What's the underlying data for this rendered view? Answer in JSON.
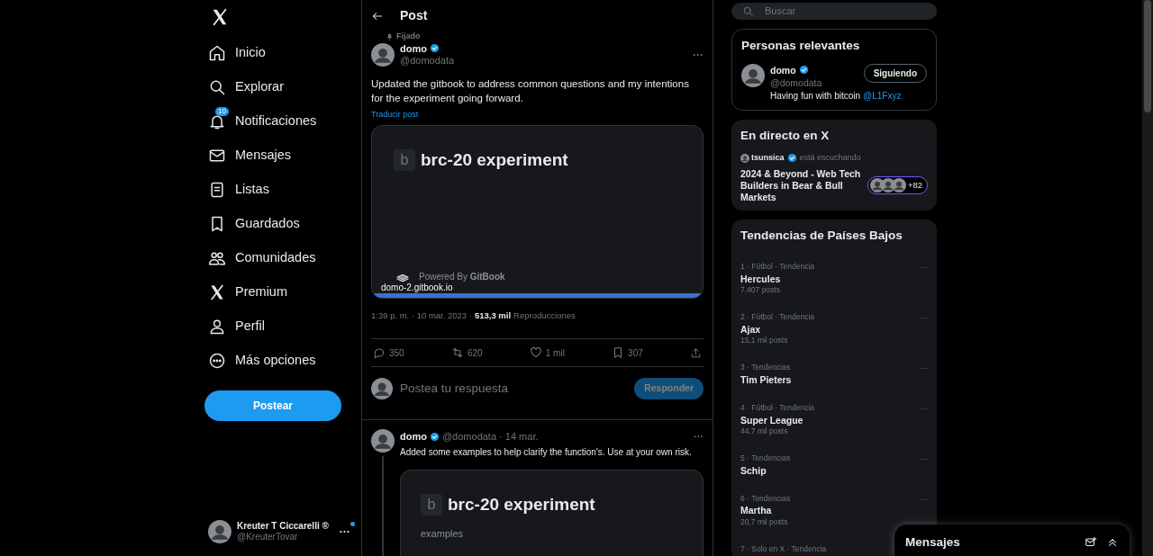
{
  "nav_items": [
    {
      "label": "Inicio"
    },
    {
      "label": "Explorar"
    },
    {
      "label": "Notificaciones",
      "badge": "10"
    },
    {
      "label": "Mensajes"
    },
    {
      "label": "Listas"
    },
    {
      "label": "Guardados"
    },
    {
      "label": "Comunidades"
    },
    {
      "label": "Premium"
    },
    {
      "label": "Perfil"
    },
    {
      "label": "Más opciones"
    }
  ],
  "post_button": "Postear",
  "account": {
    "name": "Kreuter T Ciccarelli ®",
    "handle": "@KreuterTovar",
    "more": "···",
    "unread": true
  },
  "header": {
    "title": "Post"
  },
  "post": {
    "pinned": "Fijado",
    "author": "domo",
    "verified": true,
    "handle": "@domodata",
    "more": "···",
    "text": "Updated the gitbook to address common questions and my intentions for the experiment going forward.",
    "translate": "Traducir post",
    "card": {
      "logo_letter": "b",
      "title": "brc-20 experiment",
      "powered": "Powered By **GitBook**",
      "domain": "domo-2.gitbook.io"
    },
    "time": "1:39 p. m. · 10 mar. 2023 ·",
    "views": "513,3 mil",
    "views_label": "Reproducciones",
    "actions": [
      {
        "count": "350"
      },
      {
        "count": "620"
      },
      {
        "count": "1 mil"
      },
      {
        "count": "307"
      }
    ]
  },
  "reply": {
    "placeholder": "Postea tu respuesta",
    "button": "Responder",
    "disabled": true
  },
  "thread_post": {
    "author": "domo",
    "verified": true,
    "meta": "@domodata · 14 mar.",
    "more": "···",
    "text": "Added some examples to help clarify the function's. Use at your own risk.",
    "card": {
      "logo_letter": "b",
      "title": "brc-20 experiment",
      "subtitle": "examples"
    }
  },
  "search": {
    "placeholder": "Buscar"
  },
  "relevant": {
    "title": "Personas relevantes",
    "name": "domo",
    "verified": true,
    "handle": "@domodata",
    "bio": "Having fun with bitcoin",
    "bio_link": "@L1Fxyz",
    "button": "Siguiendo"
  },
  "live": {
    "title": "En directo en X",
    "host": "tsunsica",
    "verified": true,
    "status": "está escuchando",
    "space_title": "2024 & Beyond - Web Tech Builders in Bear & Bull Markets",
    "listeners": "+82"
  },
  "trends": {
    "title": "Tendencias de Países Bajos",
    "items": [
      {
        "context": "1 · Fútbol · Tendencia",
        "name": "Hercules",
        "posts": "7.407 posts"
      },
      {
        "context": "2 · Fútbol · Tendencia",
        "name": "Ajax",
        "posts": "15,1 mil posts"
      },
      {
        "context": "3 · Tendencias",
        "name": "Tim Pieters"
      },
      {
        "context": "4 · Fútbol · Tendencia",
        "name": "Super League",
        "posts": "44,7 mil posts"
      },
      {
        "context": "5 · Tendencias",
        "name": "Schip"
      },
      {
        "context": "6 · Tendencias",
        "name": "Martha",
        "posts": "20,7 mil posts"
      },
      {
        "context": "7 · Solo en X · Tendencia"
      }
    ],
    "more": "···"
  },
  "messages_drawer": {
    "title": "Mensajes"
  }
}
